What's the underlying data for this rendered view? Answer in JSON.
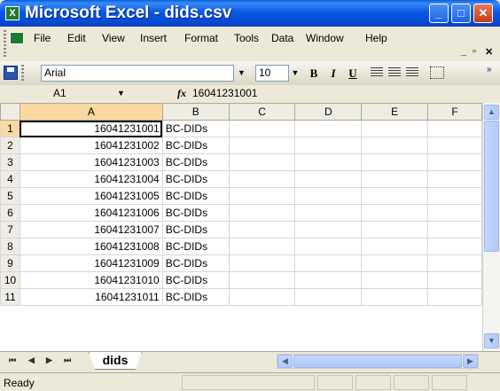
{
  "window": {
    "title": "Microsoft Excel - dids.csv",
    "app_icon": "excel-icon"
  },
  "menu": [
    "File",
    "Edit",
    "View",
    "Insert",
    "Format",
    "Tools",
    "Data",
    "Window",
    "Help"
  ],
  "toolbar": {
    "font": "Arial",
    "size": "10",
    "bold": "B",
    "italic": "I",
    "underline": "U"
  },
  "formula_bar": {
    "name_box": "A1",
    "fx": "fx",
    "value": "16041231001"
  },
  "columns": [
    "A",
    "B",
    "C",
    "D",
    "E",
    "F"
  ],
  "rows": [
    {
      "num": "1",
      "a": "16041231001",
      "b": "BC-DIDs"
    },
    {
      "num": "2",
      "a": "16041231002",
      "b": "BC-DIDs"
    },
    {
      "num": "3",
      "a": "16041231003",
      "b": "BC-DIDs"
    },
    {
      "num": "4",
      "a": "16041231004",
      "b": "BC-DIDs"
    },
    {
      "num": "5",
      "a": "16041231005",
      "b": "BC-DIDs"
    },
    {
      "num": "6",
      "a": "16041231006",
      "b": "BC-DIDs"
    },
    {
      "num": "7",
      "a": "16041231007",
      "b": "BC-DIDs"
    },
    {
      "num": "8",
      "a": "16041231008",
      "b": "BC-DIDs"
    },
    {
      "num": "9",
      "a": "16041231009",
      "b": "BC-DIDs"
    },
    {
      "num": "10",
      "a": "16041231010",
      "b": "BC-DIDs"
    },
    {
      "num": "11",
      "a": "16041231011",
      "b": "BC-DIDs"
    }
  ],
  "sheet_tab": "dids",
  "status": "Ready",
  "colors": {
    "titlebar": "#0858E6",
    "selected_header": "#F9D99F",
    "chrome": "#ECE9D8"
  }
}
